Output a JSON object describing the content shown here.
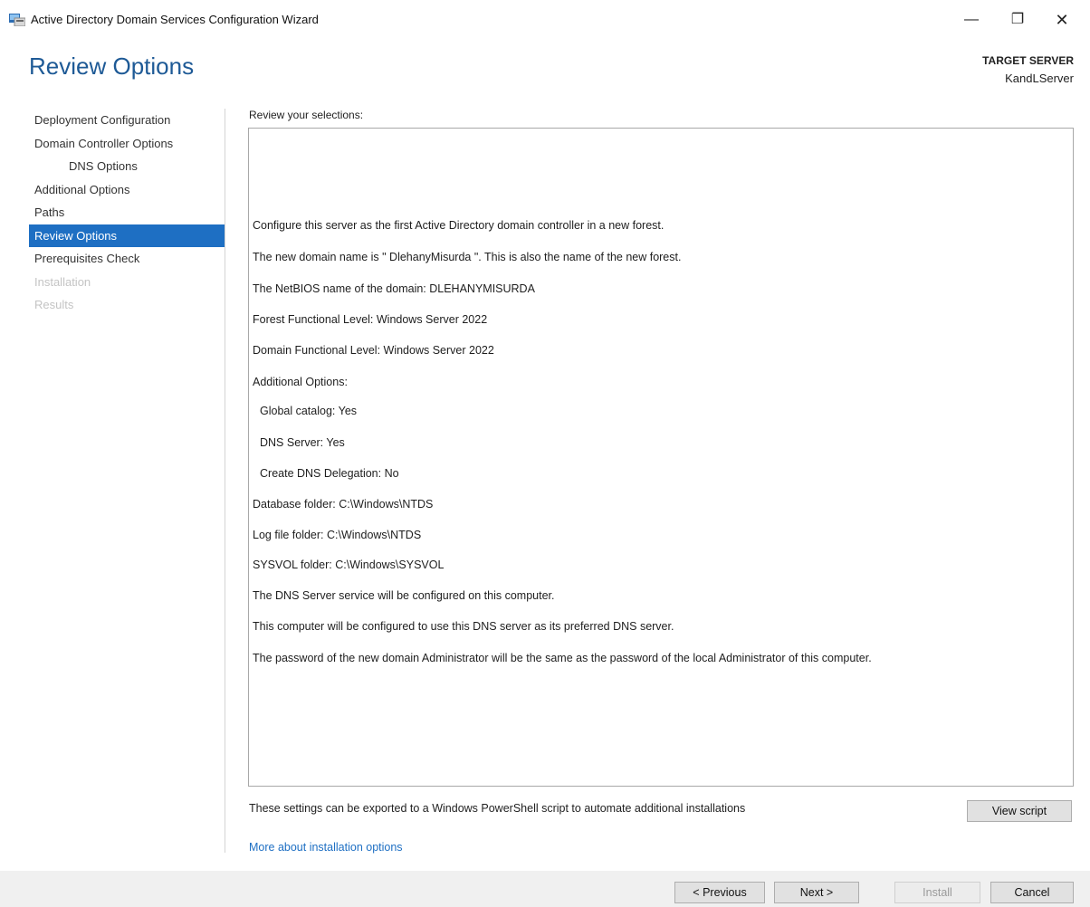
{
  "window": {
    "title": "Active Directory Domain Services Configuration Wizard",
    "min_glyph": "—",
    "max_glyph": "❐",
    "close_glyph": "✕"
  },
  "header": {
    "page_title": "Review Options",
    "target_label": "TARGET SERVER",
    "target_name": "KandLServer"
  },
  "nav": {
    "items": [
      {
        "label": "Deployment Configuration",
        "state": "normal"
      },
      {
        "label": "Domain Controller Options",
        "state": "normal"
      },
      {
        "label": "DNS Options",
        "state": "indent"
      },
      {
        "label": "Additional Options",
        "state": "normal"
      },
      {
        "label": "Paths",
        "state": "normal"
      },
      {
        "label": "Review Options",
        "state": "active"
      },
      {
        "label": "Prerequisites Check",
        "state": "normal"
      },
      {
        "label": "Installation",
        "state": "disabled"
      },
      {
        "label": "Results",
        "state": "disabled"
      }
    ]
  },
  "review": {
    "label": "Review your selections:",
    "lines": [
      "Configure this server as the first Active Directory domain controller in a new forest.",
      "The new domain name is \"  DlehanyMisurda  \". This is also the name of the new forest.",
      "The NetBIOS name of the domain:  DLEHANYMISURDA",
      "Forest Functional Level: Windows Server  2022",
      "Domain Functional Level: Windows Server  2022",
      "Additional Options:",
      "Global catalog: Yes",
      "DNS Server: Yes",
      "Create DNS Delegation: No",
      "Database folder: C:\\Windows\\NTDS",
      "Log file folder: C:\\Windows\\NTDS",
      "SYSVOL folder: C:\\Windows\\SYSVOL",
      "The DNS Server service will be configured on this computer.",
      "This computer will be configured to use this DNS server as its preferred DNS server.",
      "The password of the new domain Administrator will be the same as the password of the local Administrator of this computer."
    ]
  },
  "export_note": "These settings can be exported to a Windows PowerShell script to automate additional installations",
  "view_script_label": "View script",
  "more_link": "More about installation options",
  "footer": {
    "previous_label": "< Previous",
    "next_label": "Next >",
    "install_label": "Install",
    "cancel_label": "Cancel"
  }
}
